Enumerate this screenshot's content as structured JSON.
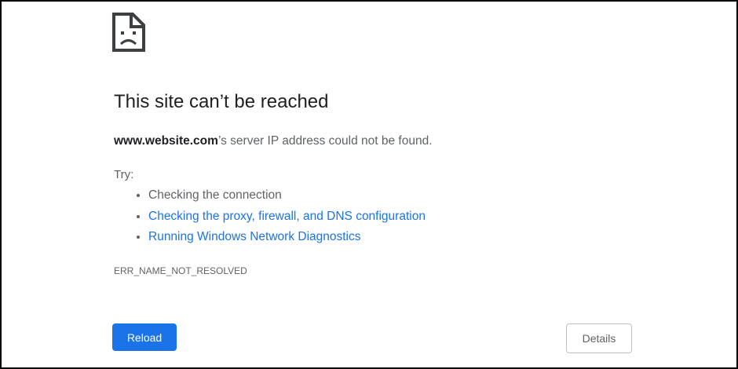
{
  "error_page": {
    "icon": "sad-document-icon",
    "title": "This site can’t be reached",
    "host": "www.website.com",
    "summary_rest": "’s server IP address could not be found.",
    "try_label": "Try:",
    "suggestions": [
      {
        "label": "Checking the connection",
        "is_link": false
      },
      {
        "label": "Checking the proxy, firewall, and DNS configuration",
        "is_link": true
      },
      {
        "label": "Running Windows Network Diagnostics",
        "is_link": true
      }
    ],
    "error_code": "ERR_NAME_NOT_RESOLVED"
  },
  "buttons": {
    "reload_label": "Reload",
    "details_label": "Details"
  },
  "colors": {
    "text_primary": "#202124",
    "text_secondary": "#5f6368",
    "link": "#1a73e8",
    "primary_button": "#1a73e8",
    "icon": "#3c4043",
    "frame_border": "#000000"
  }
}
